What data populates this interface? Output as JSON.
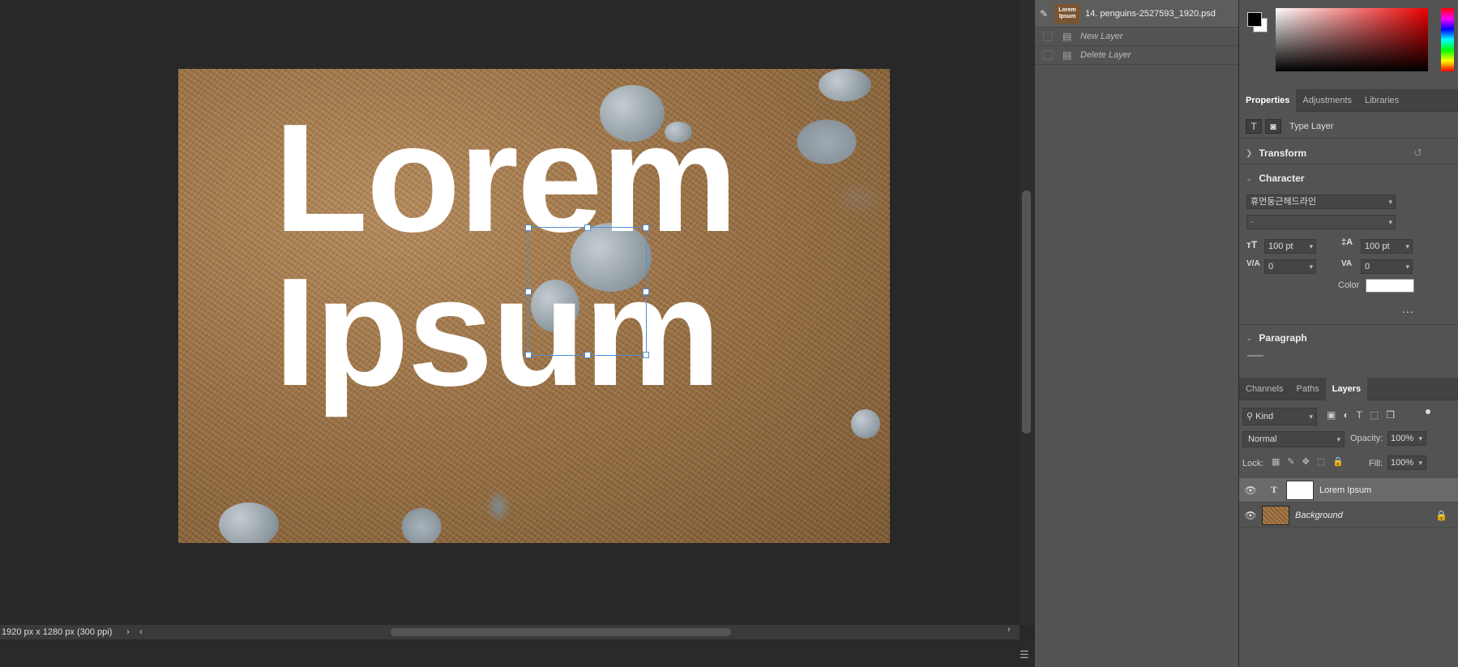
{
  "document": {
    "canvas_text_line1": "Lorem",
    "canvas_text_line2": "Ipsum",
    "status_info": "1920 px x 1280 px (300 ppi)",
    "status_arrow": "›",
    "scroll_left": "‹",
    "scroll_right": "›"
  },
  "history": {
    "snapshot_name": "14. penguins-2527593_1920.psd",
    "snapshot_thumb_text": "Lorem Ipsum",
    "items": [
      "New Layer",
      "Delete Layer"
    ]
  },
  "colors": {
    "foreground": "#000000",
    "background": "#ffffff",
    "text_color": "#ffffff",
    "selection": "#4f8fd8"
  },
  "properties_tabs": [
    "Properties",
    "Adjustments",
    "Libraries"
  ],
  "properties": {
    "layer_type": "Type Layer",
    "transform_label": "Transform",
    "character_label": "Character",
    "font_family": "휴먼둥근헤드라인",
    "font_style": "-",
    "font_size": "100 pt",
    "leading": "100 pt",
    "kerning": "0",
    "tracking": "0",
    "color_label": "Color",
    "more": "...",
    "paragraph_label": "Paragraph"
  },
  "layers_tabs": [
    "Channels",
    "Paths",
    "Layers"
  ],
  "layers_panel": {
    "kind_label": "Kind",
    "blend_mode": "Normal",
    "opacity_label": "Opacity:",
    "opacity": "100%",
    "lock_label": "Lock:",
    "fill_label": "Fill:",
    "fill": "100%",
    "layers": [
      {
        "name": "Lorem Ipsum",
        "type": "T"
      },
      {
        "name": "Background",
        "type": ""
      }
    ]
  }
}
